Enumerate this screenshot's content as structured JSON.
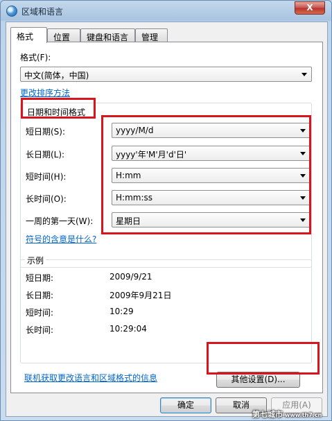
{
  "window": {
    "title": "区域和语言",
    "close_glyph": "X"
  },
  "tabs": [
    "格式",
    "位置",
    "键盘和语言",
    "管理"
  ],
  "format": {
    "label": "格式(F):",
    "value": "中文(简体，中国)",
    "change_sort_link": "更改排序方法"
  },
  "datetime": {
    "group_title": "日期和时间格式",
    "rows": [
      {
        "label": "短日期(S):",
        "value": "yyyy/M/d"
      },
      {
        "label": "长日期(L):",
        "value": "yyyy'年'M'月'd'日'"
      },
      {
        "label": "短时间(H):",
        "value": "H:mm"
      },
      {
        "label": "长时间(O):",
        "value": "H:mm:ss"
      },
      {
        "label": "一周的第一天(W):",
        "value": "星期日"
      }
    ],
    "symbols_link": "符号的含意是什么?"
  },
  "examples": {
    "title": "示例",
    "rows": [
      {
        "label": "短日期:",
        "value": "2009/9/21"
      },
      {
        "label": "长日期:",
        "value": "2009年9月21日"
      },
      {
        "label": "短时间:",
        "value": "10:29"
      },
      {
        "label": "长时间:",
        "value": "10:29:04"
      }
    ]
  },
  "other_settings_button": "其他设置(D)...",
  "online_link": "联机获取更改语言和区域格式的信息",
  "footer": {
    "ok": "确定",
    "cancel": "取消",
    "apply": "应用(A)"
  },
  "watermark": {
    "text": "第七城市",
    "url": "www.th7.cn"
  },
  "colors": {
    "highlight_red": "#d8141c",
    "link_blue": "#0066cc"
  }
}
